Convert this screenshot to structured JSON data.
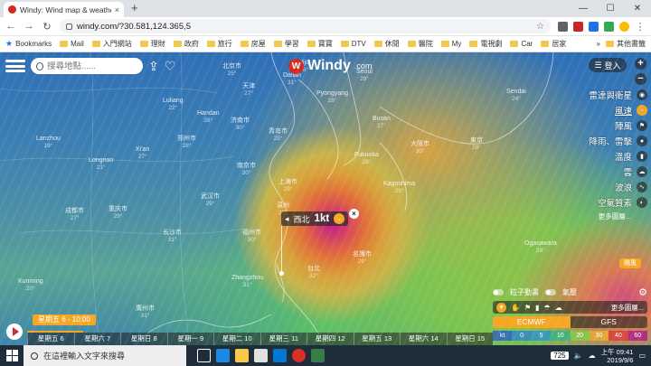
{
  "browser": {
    "tab_title": "Windy: Wind map & weather f",
    "tab_close": "×",
    "new_tab": "+",
    "url": "windy.com/?30.581,124.365,5",
    "window_controls": [
      "—",
      "☐",
      "✕"
    ]
  },
  "bookmarks": {
    "items": [
      "Bookmarks",
      "Mail",
      "入門網站",
      "理財",
      "政府",
      "旅行",
      "房屋",
      "學習",
      "寶寶",
      "DTV",
      "休閒",
      "醫院",
      "My",
      "電視劇",
      "Car",
      "居家"
    ],
    "more": "»",
    "other": "其他書籤"
  },
  "map": {
    "search_placeholder": "搜尋地點......",
    "logo_text": "Windy",
    "logo_suffix": ".com",
    "login_label": "登入",
    "zoom_in": "+",
    "zoom_out": "−",
    "layers": [
      {
        "label": "雷達與衛星",
        "icon": "satellite-icon",
        "active": false
      },
      {
        "label": "風速",
        "icon": "wind-icon",
        "active": true
      },
      {
        "label": "陣風",
        "icon": "flag-icon",
        "active": false
      },
      {
        "label": "降雨、雷擊",
        "icon": "rain-icon",
        "active": false
      },
      {
        "label": "溫度",
        "icon": "thermometer-icon",
        "active": false
      },
      {
        "label": "雲",
        "icon": "cloud-icon",
        "active": false
      },
      {
        "label": "波浪",
        "icon": "waves-icon",
        "active": false
      },
      {
        "label": "空氣質素",
        "icon": "air-icon",
        "active": false
      }
    ],
    "layers_more": "更多圖層...",
    "picker": {
      "direction": "西北",
      "value": "1kt"
    },
    "hurricane_label": "颶風",
    "toggles": [
      {
        "label": "粒子動畫"
      },
      {
        "label": "氣壓"
      }
    ],
    "icon_row_more": "更多圖層...",
    "models": {
      "selected": "ECMWF",
      "other": "GFS"
    },
    "legend": {
      "unit": "kt",
      "values": [
        "0",
        "5",
        "10",
        "20",
        "30",
        "40",
        "60"
      ],
      "colors": [
        "#3a6fb0",
        "#3c9ab8",
        "#43b37a",
        "#8bc34a",
        "#e0a63a",
        "#d9473e",
        "#b0307e"
      ]
    },
    "timeline": {
      "current_time": "星期五 6 - 10:00",
      "days": [
        "星期五 6",
        "星期六 7",
        "星期日 8",
        "星期一 9",
        "星期二 10",
        "星期三 11",
        "星期四 12",
        "星期五 13",
        "星期六 14",
        "星期日 15"
      ],
      "progress": 0.03
    },
    "cities": [
      {
        "name": "Dalian",
        "sub": "31°"
      },
      {
        "name": "北京市",
        "sub": "25°"
      },
      {
        "name": "天津",
        "sub": "27°"
      },
      {
        "name": "Handan",
        "sub": "28°"
      },
      {
        "name": "济南市",
        "sub": "30°"
      },
      {
        "name": "青岛市",
        "sub": "25°"
      },
      {
        "name": "Xi'an",
        "sub": "27°"
      },
      {
        "name": "郑州市",
        "sub": "28°"
      },
      {
        "name": "Lanzhou",
        "sub": "19°"
      },
      {
        "name": "Luliang",
        "sub": "22°"
      },
      {
        "name": "南京市",
        "sub": "30°"
      },
      {
        "name": "上海市",
        "sub": "29°"
      },
      {
        "name": "Longnan",
        "sub": "21°"
      },
      {
        "name": "武汉市",
        "sub": "29°"
      },
      {
        "name": "成都市",
        "sub": "27°"
      },
      {
        "name": "重庆市",
        "sub": "29°"
      },
      {
        "name": "长沙市",
        "sub": "31°"
      },
      {
        "name": "温州",
        "sub": "29°"
      },
      {
        "name": "福州市",
        "sub": "30°"
      },
      {
        "name": "Zhangzhou",
        "sub": "31°"
      },
      {
        "name": "台北",
        "sub": "32°"
      },
      {
        "name": "Seoul",
        "sub": "29°"
      },
      {
        "name": "Busan",
        "sub": "27°"
      },
      {
        "name": "Fukuoka",
        "sub": "29°"
      },
      {
        "name": "Kagoshima",
        "sub": "29°"
      },
      {
        "name": "大阪市",
        "sub": "30°"
      },
      {
        "name": "東京",
        "sub": "28°"
      },
      {
        "name": "Sendai",
        "sub": "24°"
      },
      {
        "name": "Ogasawara",
        "sub": "28°"
      },
      {
        "name": "名護市",
        "sub": "29°"
      },
      {
        "name": "Kunming",
        "sub": "20°"
      },
      {
        "name": "廣州市",
        "sub": "31°"
      },
      {
        "name": "Pyongyang",
        "sub": "28°"
      },
      {
        "name": "Uiju",
        "sub": "26°"
      }
    ]
  },
  "taskbar": {
    "search_placeholder": "在這裡輸入文字來搜尋",
    "ime": "725",
    "time": "上午 09:41",
    "date": "2019/9/6"
  }
}
